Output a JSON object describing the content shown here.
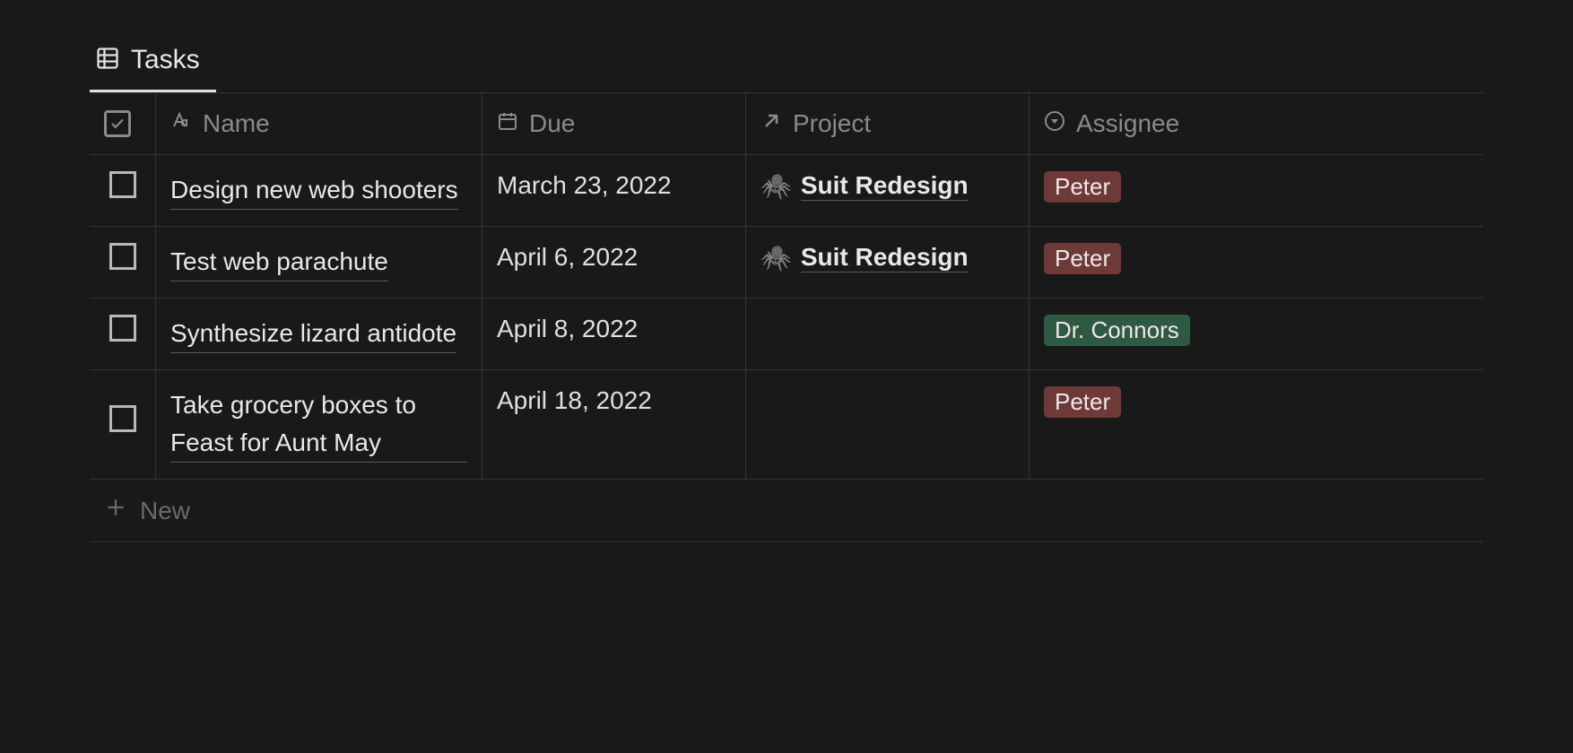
{
  "tab": {
    "label": "Tasks"
  },
  "columns": {
    "name": "Name",
    "due": "Due",
    "project": "Project",
    "assignee": "Assignee"
  },
  "rows": [
    {
      "name": "Design new web shooters",
      "due": "March 23, 2022",
      "project_emoji": "🕷️",
      "project": "Suit Redesign",
      "assignee": "Peter",
      "assignee_color": "red"
    },
    {
      "name": "Test web parachute",
      "due": "April 6, 2022",
      "project_emoji": "🕷️",
      "project": "Suit Redesign",
      "assignee": "Peter",
      "assignee_color": "red"
    },
    {
      "name": "Synthesize lizard antidote",
      "due": "April 8, 2022",
      "project_emoji": "",
      "project": "",
      "assignee": "Dr. Connors",
      "assignee_color": "green"
    },
    {
      "name": "Take grocery boxes to Feast for Aunt May",
      "due": "April 18, 2022",
      "project_emoji": "",
      "project": "",
      "assignee": "Peter",
      "assignee_color": "red"
    }
  ],
  "new_label": "New"
}
